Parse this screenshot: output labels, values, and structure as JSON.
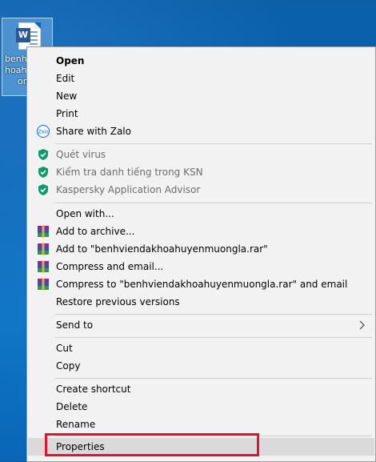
{
  "desktop": {
    "file_label_lines": [
      "benh",
      "hoah",
      "ong"
    ]
  },
  "menu": {
    "items": [
      {
        "label": "Open"
      },
      {
        "label": "Edit"
      },
      {
        "label": "New"
      },
      {
        "label": "Print"
      },
      {
        "label": "Share with Zalo",
        "icon": "zalo-icon"
      },
      {
        "label": "Quét virus",
        "icon": "kaspersky-icon"
      },
      {
        "label": "Kiểm tra danh tiếng trong KSN",
        "icon": "kaspersky-icon"
      },
      {
        "label": "Kaspersky Application Advisor",
        "icon": "kaspersky-icon"
      },
      {
        "label": "Open with..."
      },
      {
        "label": "Add to archive...",
        "icon": "winrar-icon"
      },
      {
        "label": "Add to \"benhviendakhoahuyenmuongla.rar\"",
        "icon": "winrar-icon"
      },
      {
        "label": "Compress and email...",
        "icon": "winrar-icon"
      },
      {
        "label": "Compress to \"benhviendakhoahuyenmuongla.rar\" and email",
        "icon": "winrar-icon"
      },
      {
        "label": "Restore previous versions"
      },
      {
        "label": "Send to"
      },
      {
        "label": "Cut"
      },
      {
        "label": "Copy"
      },
      {
        "label": "Create shortcut"
      },
      {
        "label": "Delete"
      },
      {
        "label": "Rename"
      },
      {
        "label": "Properties"
      }
    ],
    "zalo_text": "Zalo"
  },
  "colors": {
    "highlight": "#dadada",
    "kaspersky": "#0f9a6c",
    "annotation_box": "#e5122f"
  }
}
